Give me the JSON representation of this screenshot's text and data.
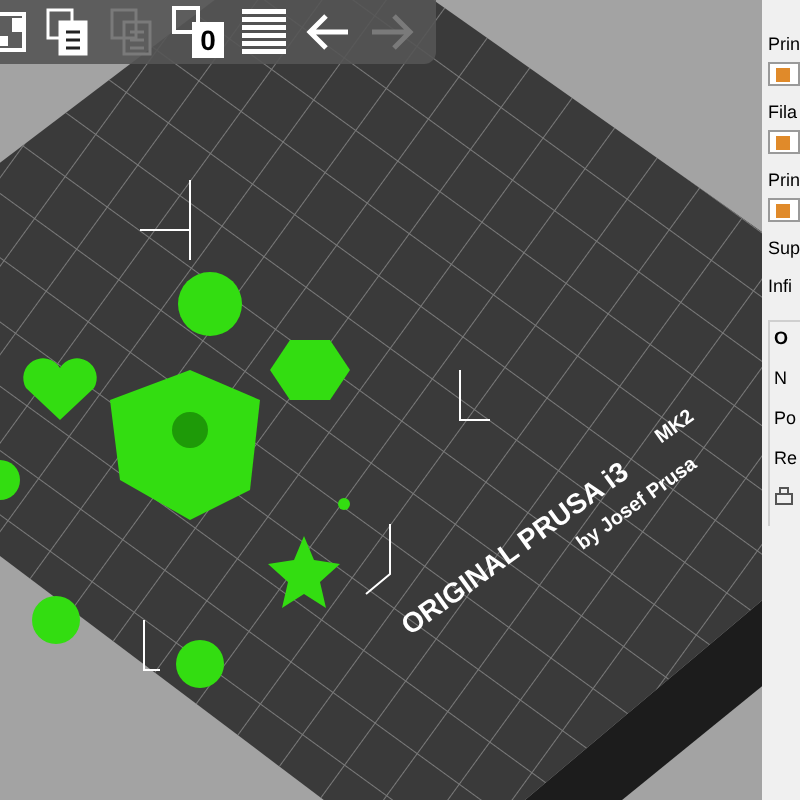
{
  "toolbar": [
    {
      "kind": "layout",
      "disabled": false
    },
    {
      "kind": "copy",
      "disabled": false
    },
    {
      "kind": "paste",
      "disabled": true
    },
    {
      "kind": "instances",
      "text": "0",
      "disabled": false
    },
    {
      "kind": "layers",
      "disabled": false
    },
    {
      "kind": "undo",
      "disabled": false
    },
    {
      "kind": "redo",
      "disabled": true
    }
  ],
  "bed": {
    "label": "ORIGINAL PRUSA i3",
    "model": "MK2",
    "maker": "by Josef Prusa"
  },
  "sidebar": {
    "items": [
      {
        "kind": "label",
        "text": "Prin"
      },
      {
        "kind": "combo"
      },
      {
        "kind": "label",
        "text": "Fila"
      },
      {
        "kind": "combo"
      },
      {
        "kind": "label",
        "text": "Prin"
      },
      {
        "kind": "combo"
      },
      {
        "kind": "label",
        "text": "Sup"
      },
      {
        "kind": "label",
        "text": "Infi"
      }
    ],
    "group": {
      "title": "O",
      "rows": [
        "N",
        "Po",
        "Re"
      ]
    }
  }
}
